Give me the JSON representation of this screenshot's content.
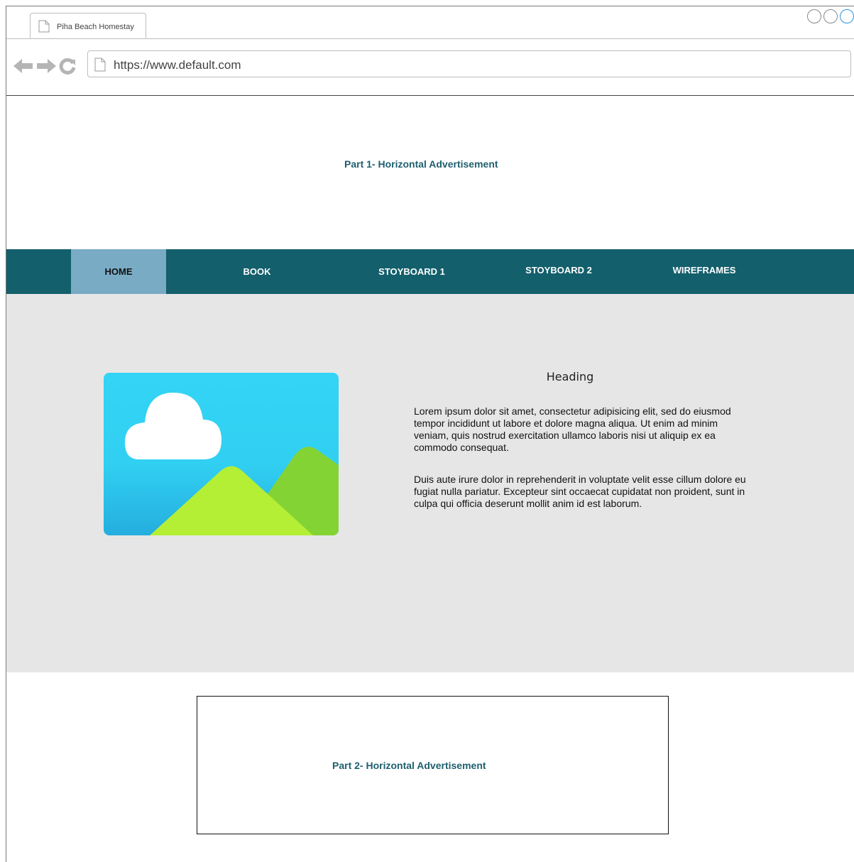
{
  "browser": {
    "tab_title": "Piha Beach Homestay",
    "url": "https://www.default.com",
    "icons": [
      "page-icon",
      "back-arrow-icon",
      "forward-arrow-icon",
      "reload-icon"
    ]
  },
  "ad_top": {
    "label": "Part 1- Horizontal Advertisement"
  },
  "nav": {
    "items": [
      {
        "label": "HOME",
        "active": true
      },
      {
        "label": "BOOK"
      },
      {
        "label": "STOYBOARD 1"
      },
      {
        "label": "STOYBOARD 2"
      },
      {
        "label": "WIREFRAMES"
      }
    ]
  },
  "main": {
    "image_icon": "image-placeholder-icon",
    "heading": "Heading",
    "paragraph1": "Lorem ipsum dolor sit amet, consectetur adipisicing elit, sed do eiusmod tempor incididunt ut labore et dolore magna aliqua. Ut enim ad minim veniam, quis nostrud exercitation ullamco laboris nisi ut aliquip ex ea commodo consequat.",
    "paragraph2": "Duis aute irure dolor in reprehenderit in voluptate velit esse cillum dolore eu fugiat nulla pariatur. Excepteur sint occaecat cupidatat non proident, sunt in culpa qui officia deserunt mollit anim id est laborum."
  },
  "ad_bottom": {
    "label": "Part 2- Horizontal Advertisement"
  },
  "colors": {
    "nav_bg": "#135f6c",
    "nav_active": "#7aabc5",
    "content_bg": "#e6e6e6",
    "ad_text": "#1e5f6e"
  }
}
